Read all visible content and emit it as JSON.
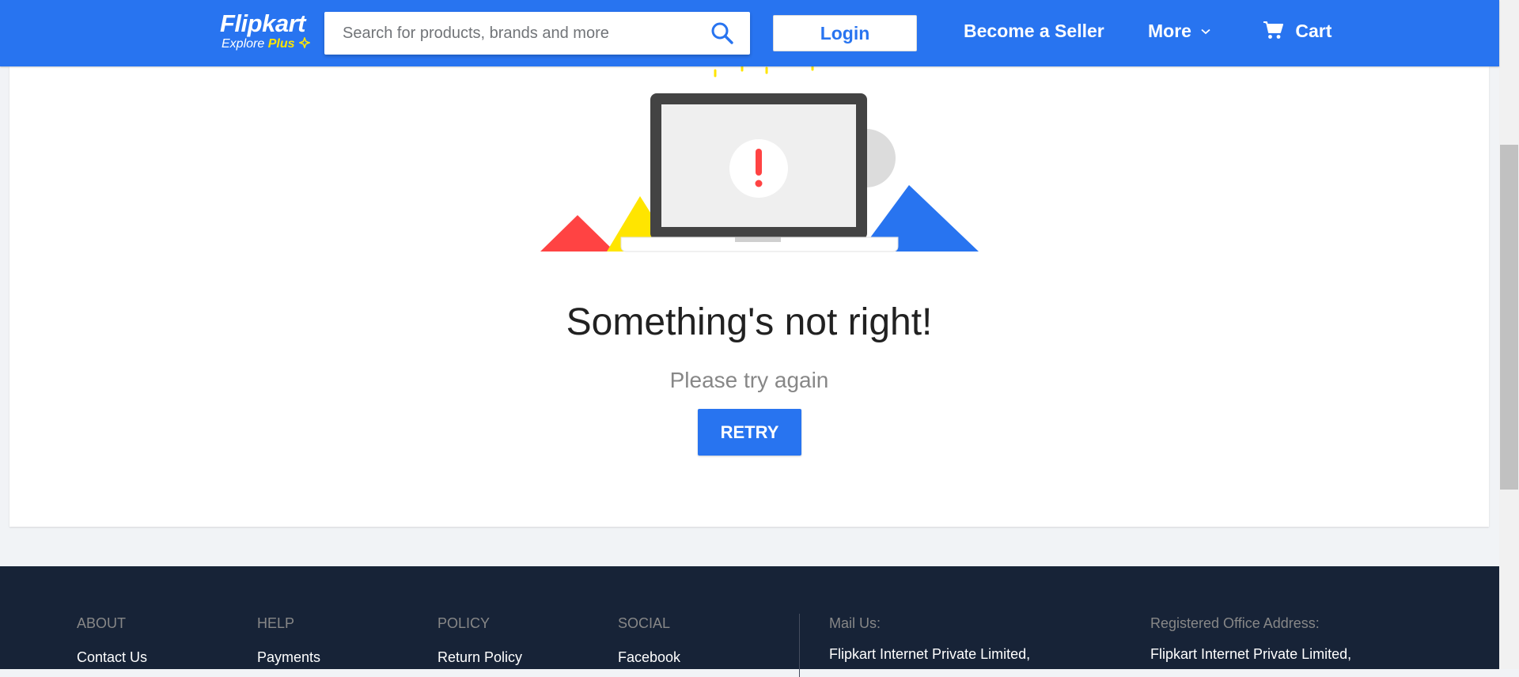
{
  "header": {
    "logo": {
      "name": "Flipkart",
      "tagline_prefix": "Explore",
      "tagline_plus": "Plus"
    },
    "search": {
      "placeholder": "Search for products, brands and more",
      "value": ""
    },
    "login_label": "Login",
    "seller_label": "Become a Seller",
    "more_label": "More",
    "cart_label": "Cart"
  },
  "error": {
    "title": "Something's not right!",
    "subtitle": "Please try again",
    "retry_label": "RETRY"
  },
  "footer": {
    "columns": [
      {
        "heading": "ABOUT",
        "first_link": "Contact Us"
      },
      {
        "heading": "HELP",
        "first_link": "Payments"
      },
      {
        "heading": "POLICY",
        "first_link": "Return Policy"
      },
      {
        "heading": "SOCIAL",
        "first_link": "Facebook"
      }
    ],
    "mail": {
      "heading": "Mail Us:",
      "line1": "Flipkart Internet Private Limited,"
    },
    "office": {
      "heading": "Registered Office Address:",
      "line1": "Flipkart Internet Private Limited,"
    }
  },
  "colors": {
    "brand_blue": "#2874f0",
    "brand_yellow": "#ffe500",
    "footer_bg": "#172337",
    "error_red": "#ff4343"
  },
  "icons": [
    "search-icon",
    "plus-icon",
    "chevron-down-icon",
    "cart-icon",
    "warning-icon"
  ]
}
